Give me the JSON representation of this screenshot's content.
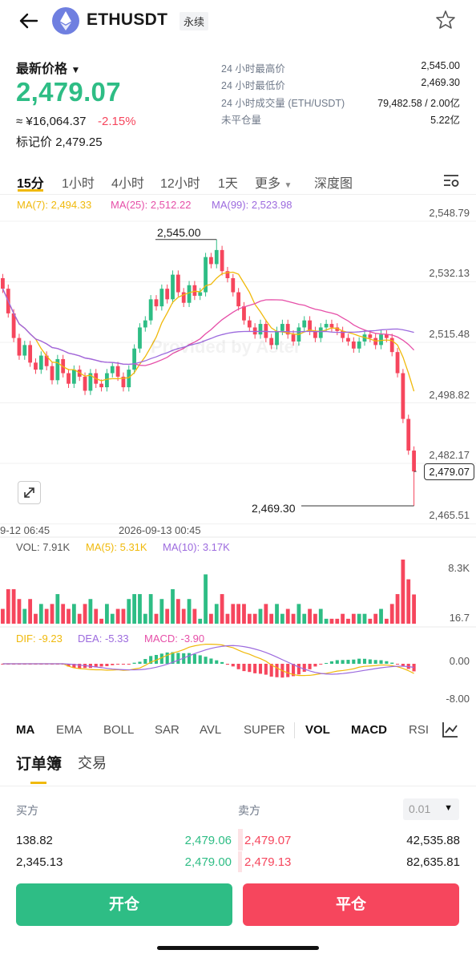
{
  "header": {
    "symbol": "ETHUSDT",
    "contract_type": "永续",
    "back_icon": "arrow-left-icon",
    "logo": "eth-logo",
    "favorite_icon": "star-icon"
  },
  "summary": {
    "latest_label": "最新价格",
    "latest_price": "2,479.07",
    "cny_value": "≈ ¥16,064.37",
    "change_pct": "-2.15%",
    "mark_price_label": "标记价",
    "mark_price": "2,479.25",
    "stats": [
      {
        "label": "24 小时最高价",
        "value": "2,545.00"
      },
      {
        "label": "24 小时最低价",
        "value": "2,469.30"
      },
      {
        "label": "24 小时成交量 (ETH/USDT)",
        "value": "79,482.58 / 2.00亿"
      },
      {
        "label": "未平仓量",
        "value": "5.22亿"
      }
    ]
  },
  "timeframes": {
    "items": [
      "15分",
      "1小时",
      "4小时",
      "12小时",
      "1天",
      "更多"
    ],
    "depth": "深度图",
    "active": "15分"
  },
  "chart_data": {
    "type": "candlestick",
    "ma_legend": [
      {
        "label": "MA(7): 2,494.33",
        "color": "#f0b90b"
      },
      {
        "label": "MA(25): 2,512.22",
        "color": "#e64fa8"
      },
      {
        "label": "MA(99): 2,523.98",
        "color": "#9c6ade"
      }
    ],
    "y_ticks": [
      "2,548.79",
      "2,532.13",
      "2,515.48",
      "2,498.82",
      "2,482.17",
      "2,465.51"
    ],
    "ylim": [
      2462,
      2552
    ],
    "high_label": "2,545.00",
    "low_label": "2,469.30",
    "current_price_label": "2,479.07",
    "x_labels": [
      "9-12 06:45",
      "2026-09-13 00:45"
    ],
    "watermark": "Provided by Aster",
    "closes": [
      2531,
      2524,
      2517,
      2512,
      2515,
      2510,
      2508,
      2512,
      2509,
      2505,
      2511,
      2507,
      2504,
      2508,
      2506,
      2502,
      2507,
      2504,
      2503,
      2507,
      2509,
      2506,
      2503,
      2508,
      2514,
      2520,
      2522,
      2528,
      2526,
      2531,
      2528,
      2535,
      2530,
      2527,
      2532,
      2529,
      2530,
      2540,
      2538,
      2542,
      2536,
      2534,
      2530,
      2526,
      2522,
      2520,
      2518,
      2521,
      2517,
      2515,
      2519,
      2521,
      2518,
      2516,
      2520,
      2522,
      2519,
      2517,
      2520,
      2521,
      2520,
      2519,
      2517,
      2516,
      2514,
      2516,
      2518,
      2517,
      2515,
      2518,
      2517,
      2513,
      2507,
      2494,
      2485,
      2479.07
    ],
    "volume": {
      "legend": [
        {
          "label": "VOL: 7.91K",
          "color": "#555"
        },
        {
          "label": "MA(5): 5.31K",
          "color": "#f0b90b"
        },
        {
          "label": "MA(10): 3.17K",
          "color": "#9c6ade"
        }
      ],
      "y_ticks": [
        "8.3K",
        "16.7"
      ]
    },
    "macd": {
      "legend": [
        {
          "label": "DIF: -9.23",
          "color": "#f0b90b"
        },
        {
          "label": "DEA: -5.33",
          "color": "#9c6ade"
        },
        {
          "label": "MACD: -3.90",
          "color": "#e64fa8"
        }
      ],
      "y_ticks": [
        "0.00",
        "-8.00"
      ]
    }
  },
  "indicators": {
    "items": [
      "MA",
      "EMA",
      "BOLL",
      "SAR",
      "AVL",
      "SUPER",
      "VOL",
      "MACD",
      "RSI"
    ]
  },
  "order_book": {
    "tabs": [
      "订单簿",
      "交易"
    ],
    "buy_label": "买方",
    "sell_label": "卖方",
    "precision": "0.01",
    "rows": [
      {
        "buy_qty": "138.82",
        "buy_price": "2,479.06",
        "sell_price": "2,479.07",
        "sell_qty": "42,535.88"
      },
      {
        "buy_qty": "2,345.13",
        "buy_price": "2,479.00",
        "sell_price": "2,479.13",
        "sell_qty": "82,635.81"
      }
    ]
  },
  "actions": {
    "open": "开仓",
    "close": "平仓",
    "open_color": "#2ebd85",
    "close_color": "#f6465d"
  }
}
